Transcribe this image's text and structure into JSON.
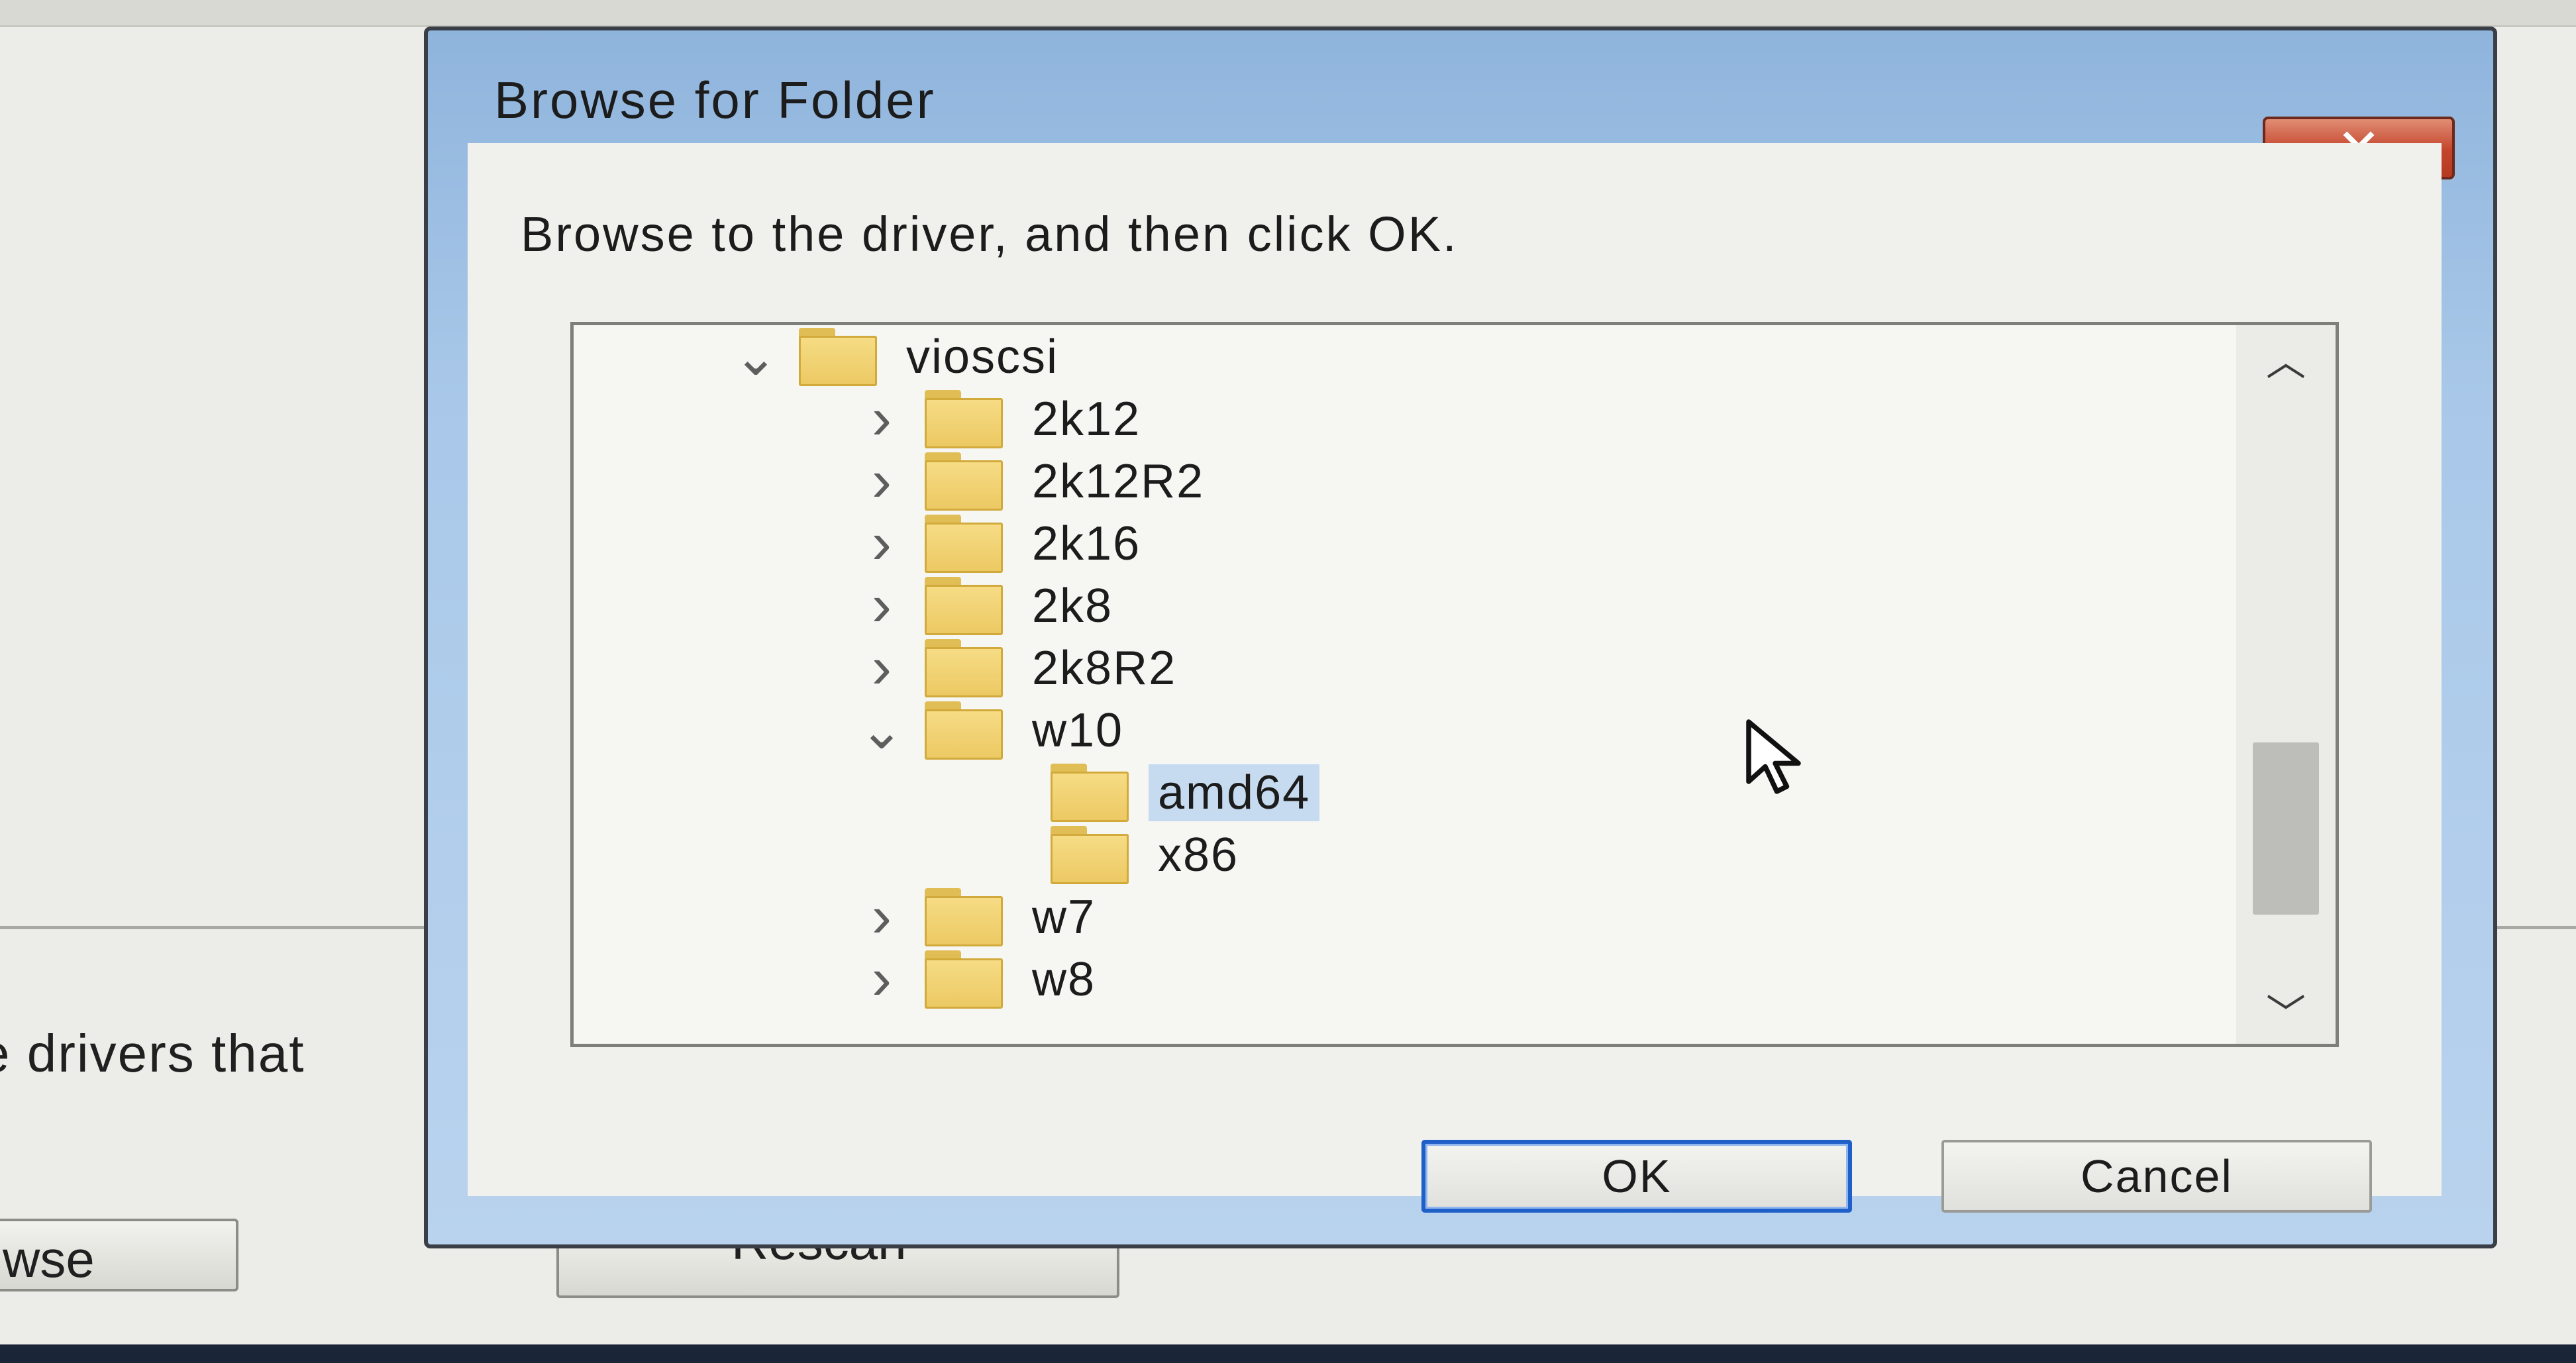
{
  "background": {
    "text_fragment": "e drivers that",
    "browse_button_label": "wse",
    "rescan_button_label": "Rescan"
  },
  "dialog": {
    "title": "Browse for Folder",
    "close_icon": "close-x-icon",
    "instruction": "Browse to the driver, and then click OK.",
    "tree": [
      {
        "label": "vioscsi",
        "level": 0,
        "expander": "expanded"
      },
      {
        "label": "2k12",
        "level": 1,
        "expander": "collapsed"
      },
      {
        "label": "2k12R2",
        "level": 1,
        "expander": "collapsed"
      },
      {
        "label": "2k16",
        "level": 1,
        "expander": "collapsed"
      },
      {
        "label": "2k8",
        "level": 1,
        "expander": "collapsed"
      },
      {
        "label": "2k8R2",
        "level": 1,
        "expander": "collapsed"
      },
      {
        "label": "w10",
        "level": 1,
        "expander": "expanded"
      },
      {
        "label": "amd64",
        "level": 2,
        "expander": "none",
        "selected": true
      },
      {
        "label": "x86",
        "level": 2,
        "expander": "none"
      },
      {
        "label": "w7",
        "level": 1,
        "expander": "collapsed"
      },
      {
        "label": "w8",
        "level": 1,
        "expander": "collapsed"
      }
    ],
    "ok_label": "OK",
    "cancel_label": "Cancel"
  },
  "colors": {
    "title_bar": "#a9c8e9",
    "close_button": "#c4442b",
    "selection": "#c6dbef",
    "folder": "#f6dc85",
    "ok_focus_border": "#1f5fc8"
  }
}
